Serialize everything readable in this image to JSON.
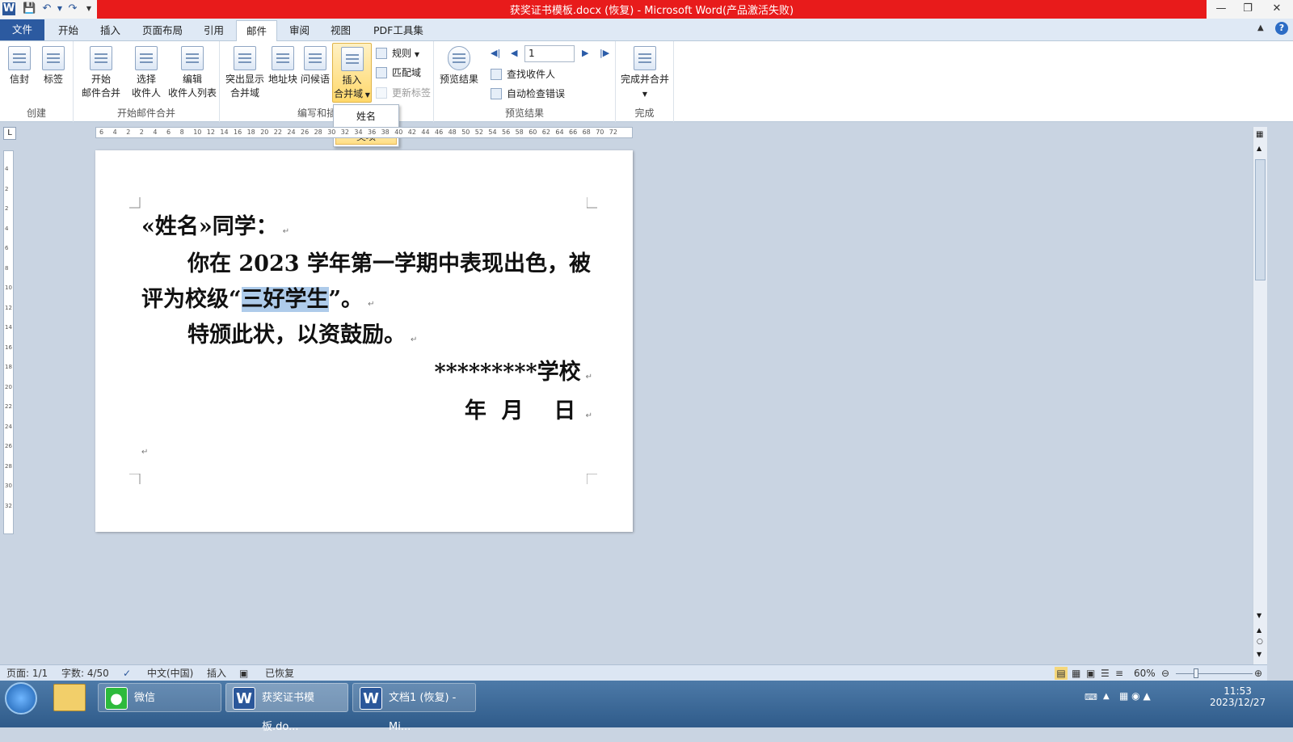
{
  "window": {
    "title": "获奖证书模板.docx (恢复)  -  Microsoft Word(产品激活失败)",
    "app_icon": "W"
  },
  "tabs": [
    {
      "label": "文件"
    },
    {
      "label": "开始"
    },
    {
      "label": "插入"
    },
    {
      "label": "页面布局"
    },
    {
      "label": "引用"
    },
    {
      "label": "邮件"
    },
    {
      "label": "审阅"
    },
    {
      "label": "视图"
    },
    {
      "label": "PDF工具集"
    }
  ],
  "ribbon": {
    "create": {
      "label": "创建",
      "envelopes": "信封",
      "labels": "标签"
    },
    "start": {
      "label": "开始邮件合并",
      "start_merge": [
        "开始",
        "邮件合并"
      ],
      "select_recipients": [
        "选择",
        "收件人"
      ],
      "edit_list": [
        "编辑",
        "收件人列表"
      ]
    },
    "write": {
      "label": "编写和插入域",
      "highlight": [
        "突出显示",
        "合并域"
      ],
      "address": "地址块",
      "greeting": "问候语",
      "insert_field": [
        "插入",
        "合并域"
      ],
      "rules": "规则",
      "match": "匹配域",
      "update_labels": "更新标签"
    },
    "preview": {
      "label": "预览结果",
      "preview_btn": "预览结果",
      "record": "1",
      "find": "查找收件人",
      "check": "自动检查错误"
    },
    "finish": {
      "label": "完成",
      "finish_btn": "完成并合并"
    }
  },
  "dropdown": {
    "items": [
      "姓名",
      "奖项"
    ]
  },
  "ruler": {
    "ticks": [
      "6",
      "4",
      "2",
      "2",
      "4",
      "6",
      "8",
      "10",
      "12",
      "14",
      "16",
      "18",
      "20",
      "22",
      "24",
      "26",
      "28",
      "30",
      "32",
      "34",
      "36",
      "38",
      "40",
      "42",
      "44",
      "46",
      "48",
      "50",
      "52",
      "54",
      "56",
      "58",
      "60",
      "62",
      "64",
      "66",
      "68",
      "70",
      "72"
    ],
    "vticks": [
      "4",
      "2",
      "2",
      "4",
      "6",
      "8",
      "10",
      "12",
      "14",
      "16",
      "18",
      "20",
      "22",
      "24",
      "26",
      "28",
      "30",
      "32"
    ]
  },
  "document": {
    "greeting": "«姓名»同学：",
    "line1": "你在 2023 学年第一学期中表现出色，被",
    "line2_pre": "评为校级“",
    "line2_sel": "三好学生",
    "line2_post": "”。",
    "line3": "特颁此状，以资鼓励。",
    "school": "*********学校",
    "date": "年  月    日"
  },
  "status": {
    "page": "页面: 1/1",
    "words": "字数: 4/50",
    "lang": "中文(中国)",
    "mode": "插入",
    "recovered": "已恢复",
    "zoom": "60%"
  },
  "taskbar": {
    "wechat": "微信",
    "word1": "获奖证书模板.do...",
    "word2": "文档1 (恢复) - Mi...",
    "time": "11:53",
    "date": "2023/12/27"
  }
}
